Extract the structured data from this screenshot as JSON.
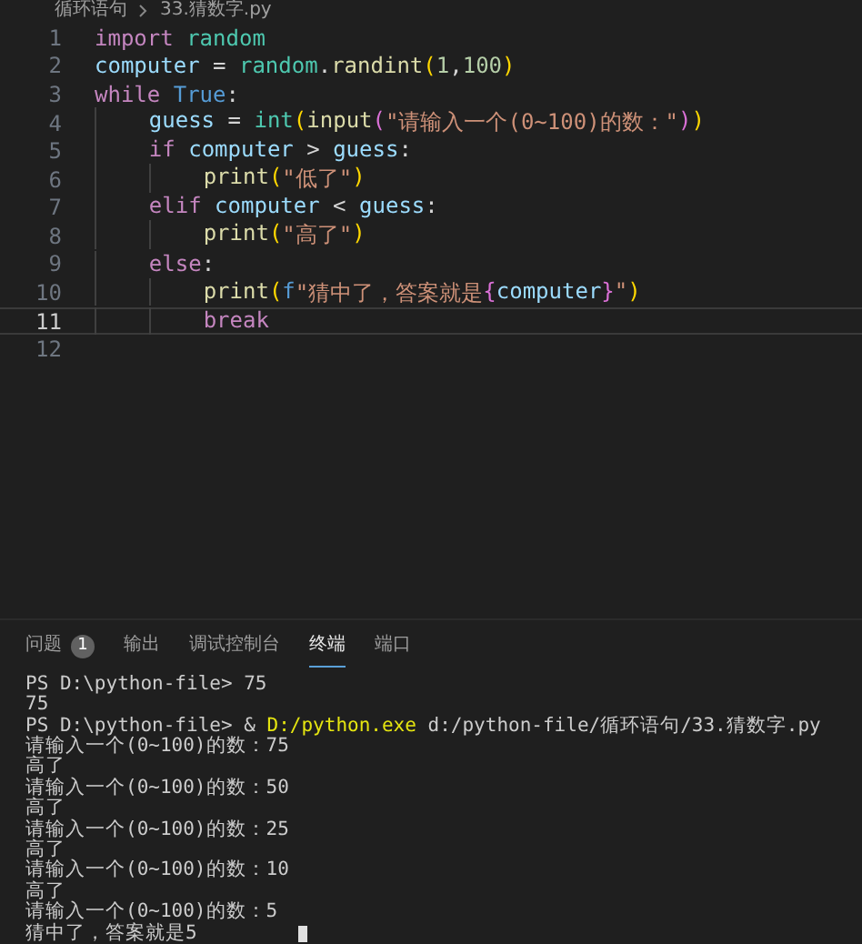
{
  "breadcrumb": [
    "循环语句",
    "33.猜数字.py"
  ],
  "editor": {
    "lines": [
      {
        "number": "1",
        "current": false,
        "tokens": [
          {
            "kind": "kw",
            "text": "import "
          },
          {
            "kind": "mod",
            "text": "random"
          }
        ]
      },
      {
        "number": "2",
        "current": false,
        "tokens": [
          {
            "kind": "var",
            "text": "computer"
          },
          {
            "kind": "plain",
            "text": " = "
          },
          {
            "kind": "mod",
            "text": "random"
          },
          {
            "kind": "plain",
            "text": "."
          },
          {
            "kind": "fn",
            "text": "randint"
          },
          {
            "kind": "br",
            "text": "("
          },
          {
            "kind": "num",
            "text": "1"
          },
          {
            "kind": "plain",
            "text": ","
          },
          {
            "kind": "num",
            "text": "100"
          },
          {
            "kind": "br",
            "text": ")"
          }
        ]
      },
      {
        "number": "3",
        "current": false,
        "tokens": [
          {
            "kind": "kw",
            "text": "while "
          },
          {
            "kind": "const",
            "text": "True"
          },
          {
            "kind": "plain",
            "text": ":"
          }
        ]
      },
      {
        "number": "4",
        "current": false,
        "tokens": [
          {
            "kind": "var",
            "text": "    guess"
          },
          {
            "kind": "plain",
            "text": " = "
          },
          {
            "kind": "mod",
            "text": "int"
          },
          {
            "kind": "br",
            "text": "("
          },
          {
            "kind": "fn",
            "text": "input"
          },
          {
            "kind": "br2",
            "text": "("
          },
          {
            "kind": "str",
            "text": "\"请输入一个(0~100)的数：\""
          },
          {
            "kind": "br2",
            "text": ")"
          },
          {
            "kind": "br",
            "text": ")"
          }
        ]
      },
      {
        "number": "5",
        "current": false,
        "tokens": [
          {
            "kind": "kw",
            "text": "    if "
          },
          {
            "kind": "var",
            "text": "computer"
          },
          {
            "kind": "plain",
            "text": " > "
          },
          {
            "kind": "var",
            "text": "guess"
          },
          {
            "kind": "plain",
            "text": ":"
          }
        ]
      },
      {
        "number": "6",
        "current": false,
        "tokens": [
          {
            "kind": "fn",
            "text": "        print"
          },
          {
            "kind": "br",
            "text": "("
          },
          {
            "kind": "str",
            "text": "\"低了\""
          },
          {
            "kind": "br",
            "text": ")"
          }
        ]
      },
      {
        "number": "7",
        "current": false,
        "tokens": [
          {
            "kind": "kw",
            "text": "    elif "
          },
          {
            "kind": "var",
            "text": "computer"
          },
          {
            "kind": "plain",
            "text": " < "
          },
          {
            "kind": "var",
            "text": "guess"
          },
          {
            "kind": "plain",
            "text": ":"
          }
        ]
      },
      {
        "number": "8",
        "current": false,
        "tokens": [
          {
            "kind": "fn",
            "text": "        print"
          },
          {
            "kind": "br",
            "text": "("
          },
          {
            "kind": "str",
            "text": "\"高了\""
          },
          {
            "kind": "br",
            "text": ")"
          }
        ]
      },
      {
        "number": "9",
        "current": false,
        "tokens": [
          {
            "kind": "kw",
            "text": "    else"
          },
          {
            "kind": "plain",
            "text": ":"
          }
        ]
      },
      {
        "number": "10",
        "current": false,
        "tokens": [
          {
            "kind": "fn",
            "text": "        print"
          },
          {
            "kind": "br",
            "text": "("
          },
          {
            "kind": "const",
            "text": "f"
          },
          {
            "kind": "str",
            "text": "\"猜中了，答案就是"
          },
          {
            "kind": "br2",
            "text": "{"
          },
          {
            "kind": "var",
            "text": "computer"
          },
          {
            "kind": "br2",
            "text": "}"
          },
          {
            "kind": "str",
            "text": "\""
          },
          {
            "kind": "br",
            "text": ")"
          }
        ]
      },
      {
        "number": "11",
        "current": true,
        "tokens": [
          {
            "kind": "kw",
            "text": "        break"
          }
        ]
      },
      {
        "number": "12",
        "current": false
      }
    ]
  },
  "panel_tabs": [
    {
      "label": "问题",
      "badge": "1",
      "selected": false
    },
    {
      "label": "输出",
      "selected": false
    },
    {
      "label": "调试控制台",
      "selected": false
    },
    {
      "label": "终端",
      "selected": true
    },
    {
      "label": "端口",
      "selected": false
    }
  ],
  "terminal": [
    [
      {
        "kind": "plain",
        "text": "PS D:\\python-file> 75"
      }
    ],
    [
      {
        "kind": "plain",
        "text": "75"
      }
    ],
    [
      {
        "kind": "plain",
        "text": "PS D:\\python-file> & "
      },
      {
        "kind": "fn",
        "text": "D:/python.exe"
      },
      {
        "kind": "plain",
        "text": " d:/python-file/循环语句/33.猜数字.py"
      }
    ],
    [
      {
        "kind": "plain",
        "text": "请输入一个(0~100)的数：75"
      }
    ],
    [
      {
        "kind": "plain",
        "text": "高了"
      }
    ],
    [
      {
        "kind": "plain",
        "text": "请输入一个(0~100)的数：50"
      }
    ],
    [
      {
        "kind": "plain",
        "text": "高了"
      }
    ],
    [
      {
        "kind": "plain",
        "text": "请输入一个(0~100)的数：25"
      }
    ],
    [
      {
        "kind": "plain",
        "text": "高了"
      }
    ],
    [
      {
        "kind": "plain",
        "text": "请输入一个(0~100)的数：10"
      }
    ],
    [
      {
        "kind": "plain",
        "text": "高了"
      }
    ],
    [
      {
        "kind": "plain",
        "text": "请输入一个(0~100)的数：5"
      }
    ],
    [
      {
        "kind": "plain",
        "text": "猜中了，答案就是5"
      }
    ]
  ]
}
